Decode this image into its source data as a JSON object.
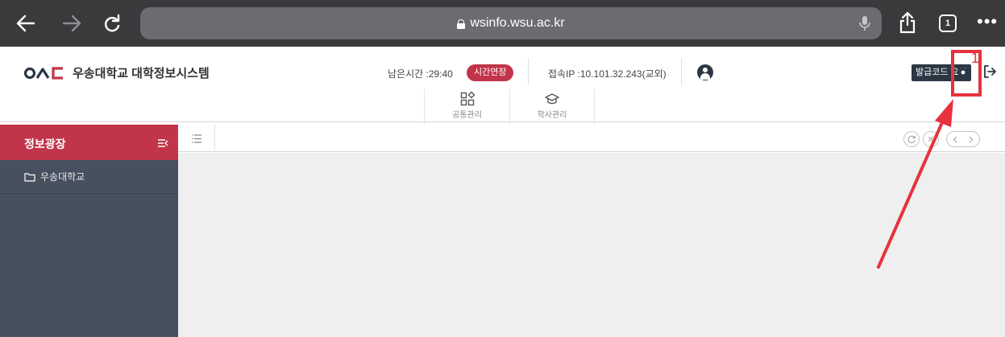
{
  "browser": {
    "url": "wsinfo.wsu.ac.kr",
    "tab_count": "1",
    "more": "•••"
  },
  "header": {
    "logo_mark": "OAC",
    "title": "우송대학교 대학정보시스템",
    "remaining_time": "남은시간 :29:40",
    "extend_button": "시간연장",
    "access_ip": "접속IP :10.101.32.243(교외)",
    "issue_code_button": "발급코드 요청"
  },
  "top_menu": {
    "items": [
      {
        "label": "공통관리",
        "icon": "grid-icon"
      },
      {
        "label": "학사관리",
        "icon": "graduation-cap-icon"
      }
    ]
  },
  "sidebar": {
    "title": "정보광장",
    "tree": [
      {
        "label": "우송대학교",
        "icon": "folder-icon"
      }
    ]
  },
  "annotation": {
    "number": "1",
    "color": "#e8323e"
  },
  "colors": {
    "accent": "#c2344a",
    "sidebar_bg": "#47505e",
    "dark": "#2c3744"
  }
}
